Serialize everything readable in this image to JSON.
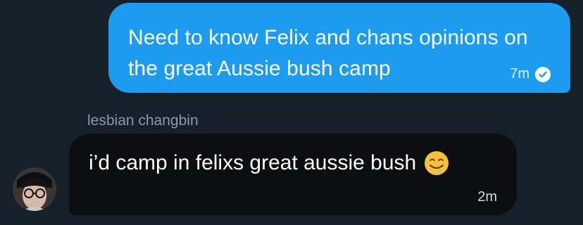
{
  "outgoing_message": {
    "text": "Need to know Felix and chans opinions on the great Aussie bush camp",
    "time": "7m",
    "status_icon": "check-circle-icon"
  },
  "incoming_message": {
    "sender": "lesbian changbin",
    "text": "i’d camp in felixs great aussie bush",
    "emoji": "drooling-face-emoji",
    "time": "2m"
  },
  "colors": {
    "background": "#15202b",
    "outgoing_bubble": "#1d9bf0",
    "incoming_bubble": "#0c0e10",
    "muted_text": "#8b98a5"
  }
}
